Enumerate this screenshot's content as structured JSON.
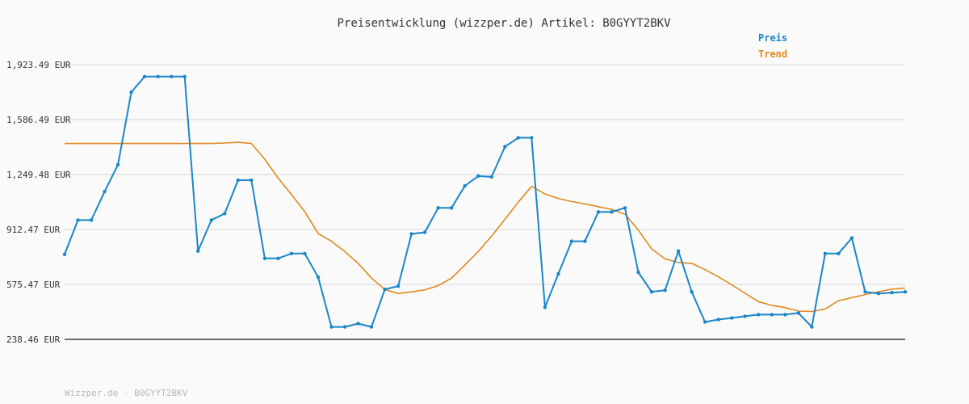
{
  "chart_data": {
    "type": "line",
    "title": "Preisentwicklung (wizzper.de) Artikel: B0GYYT2BKV",
    "xlabel": "",
    "ylabel": "",
    "y_unit": "EUR",
    "yticks": [
      "1,923.49 EUR",
      "1,586.49 EUR",
      "1,249.48 EUR",
      "912.47 EUR",
      "575.47 EUR",
      "238.46 EUR"
    ],
    "ytick_values": [
      1923.49,
      1586.49,
      1249.48,
      912.47,
      575.47,
      238.46
    ],
    "ylim": [
      238.46,
      1923.49
    ],
    "grid": true,
    "legend_position": "top-right",
    "series": [
      {
        "name": "Preis",
        "color": "#1a86c8",
        "markers": true,
        "values": [
          760,
          970,
          970,
          1145,
          1310,
          1755,
          1850,
          1850,
          1850,
          1850,
          780,
          970,
          1010,
          1215,
          1215,
          735,
          735,
          765,
          765,
          620,
          315,
          315,
          335,
          315,
          545,
          565,
          885,
          895,
          1045,
          1045,
          1180,
          1240,
          1235,
          1420,
          1475,
          1475,
          435,
          640,
          840,
          840,
          1020,
          1020,
          1045,
          650,
          530,
          540,
          780,
          530,
          345,
          360,
          370,
          380,
          390,
          390,
          390,
          400,
          315,
          765,
          765,
          860,
          530,
          520,
          525,
          530
        ]
      },
      {
        "name": "Trend",
        "color": "#e0891e",
        "markers": false,
        "values": [
          1440,
          1440,
          1440,
          1440,
          1440,
          1440,
          1440,
          1440,
          1440,
          1440,
          1440,
          1440,
          1443,
          1447,
          1440,
          1343,
          1228,
          1127,
          1022,
          887,
          840,
          777,
          705,
          614,
          544,
          520,
          530,
          542,
          568,
          614,
          694,
          777,
          872,
          975,
          1080,
          1177,
          1130,
          1103,
          1084,
          1069,
          1052,
          1036,
          1006,
          909,
          793,
          732,
          710,
          705,
          666,
          622,
          573,
          521,
          470,
          447,
          433,
          412,
          409,
          425,
          476,
          494,
          513,
          531,
          546,
          553
        ]
      }
    ]
  },
  "footer": {
    "text": "Wizzper.de - B0GYYT2BKV"
  }
}
